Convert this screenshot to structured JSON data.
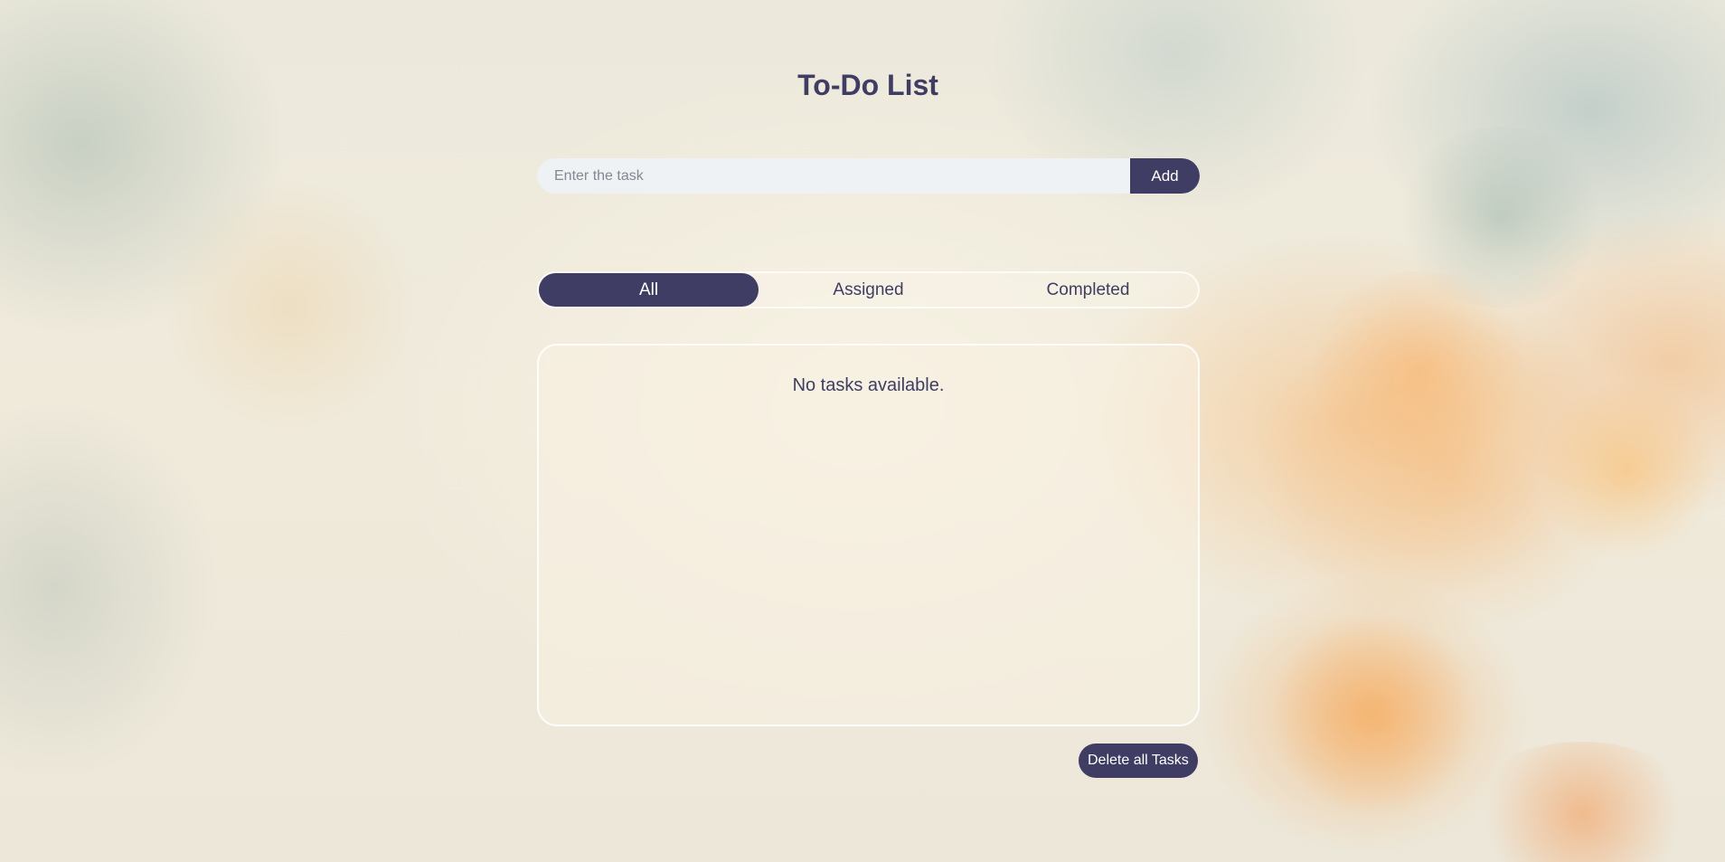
{
  "page": {
    "title": "To-Do List"
  },
  "task_entry": {
    "placeholder": "Enter the task",
    "value": "",
    "add_label": "Add"
  },
  "filter_tabs": [
    {
      "label": "All",
      "active": true
    },
    {
      "label": "Assigned",
      "active": false
    },
    {
      "label": "Completed",
      "active": false
    }
  ],
  "task_list": {
    "empty_message": "No tasks available.",
    "items": []
  },
  "actions": {
    "delete_all_label": "Delete all Tasks"
  },
  "colors": {
    "accent": "#3f3d63",
    "input_background": "#eff2f5",
    "button_text": "#ffffff"
  }
}
